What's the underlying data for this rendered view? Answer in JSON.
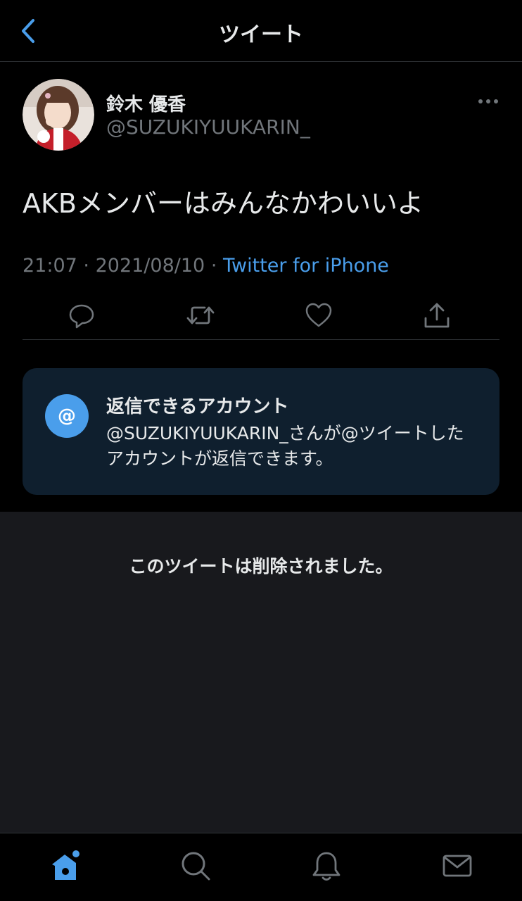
{
  "header": {
    "title": "ツイート",
    "back_icon": "chevron-left-icon"
  },
  "tweet": {
    "author": {
      "display_name": "鈴木 優香",
      "handle": "@SUZUKIYUUKARIN_"
    },
    "text": "AKBメンバーはみんなかわいいよ",
    "time": "21:07",
    "date": "2021/08/10",
    "separator": "·",
    "source": "Twitter for iPhone",
    "actions": [
      "reply-icon",
      "retweet-icon",
      "like-icon",
      "share-icon"
    ]
  },
  "reply_restriction": {
    "title": "返信できるアカウント",
    "description": "@SUZUKIYUUKARIN_さんが@ツイートしたアカウントが返信できます。",
    "icon_label": "@"
  },
  "deleted_notice": {
    "text": "このツイートは削除されました。"
  },
  "tabbar": {
    "tabs": [
      "home-icon",
      "search-icon",
      "notifications-icon",
      "messages-icon"
    ],
    "active": "home-icon"
  },
  "colors": {
    "accent": "#4a9eeb",
    "background": "#000000",
    "secondary_text": "#71767b",
    "reply_box_bg": "#0f1f2e",
    "deleted_bg": "#18191d"
  }
}
